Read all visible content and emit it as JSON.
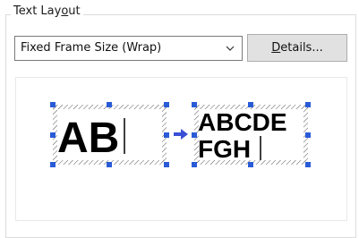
{
  "group": {
    "title_pre": "Text Lay",
    "title_acc": "o",
    "title_post": "ut"
  },
  "dropdown": {
    "value": "Fixed Frame Size (Wrap)",
    "icon": "chevron-down-icon"
  },
  "details_button": {
    "label_acc": "D",
    "label_post": "etails..."
  },
  "preview": {
    "before_text": "AB",
    "after_line1": "ABCDE",
    "after_line2": "FGH",
    "arrow_icon": "arrow-right-icon",
    "arrow_color": "#3a4fd6",
    "handle_color": "#2a5bd7"
  }
}
